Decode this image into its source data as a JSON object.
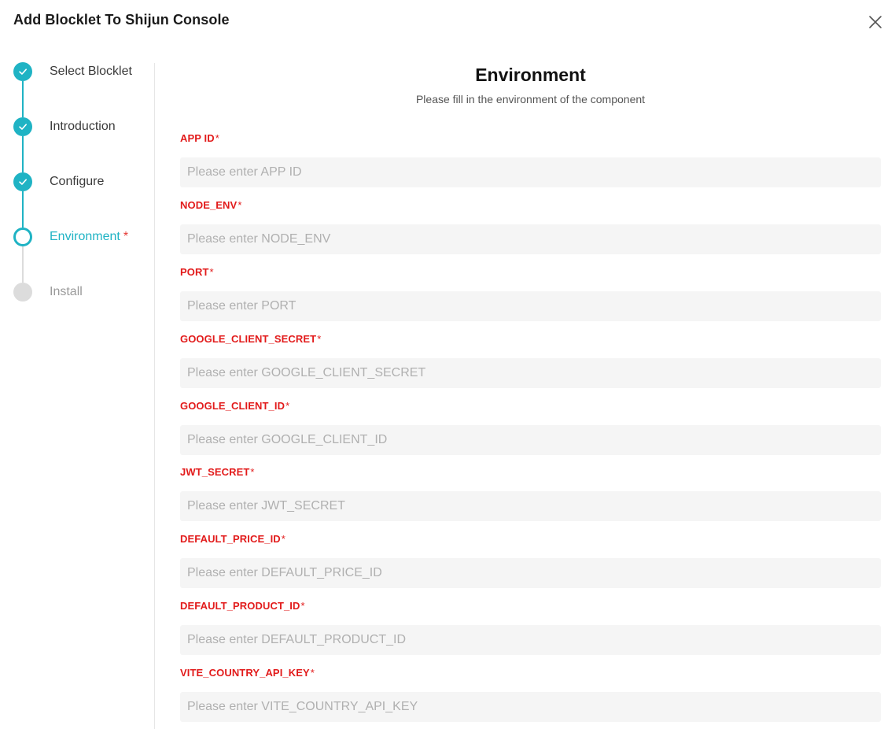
{
  "dialog": {
    "title": "Add Blocklet To Shijun Console"
  },
  "stepper": {
    "steps": [
      {
        "label": "Select Blocklet",
        "state": "done"
      },
      {
        "label": "Introduction",
        "state": "done"
      },
      {
        "label": "Configure",
        "state": "done"
      },
      {
        "label": "Environment",
        "state": "active",
        "required_mark": "*"
      },
      {
        "label": "Install",
        "state": "todo"
      }
    ]
  },
  "section": {
    "title": "Environment",
    "subtitle": "Please fill in the environment of the component"
  },
  "fields": [
    {
      "label": "APP ID",
      "star": "*",
      "value": "",
      "placeholder": "Please enter APP ID"
    },
    {
      "label": "NODE_ENV",
      "star": "*",
      "value": "",
      "placeholder": "Please enter NODE_ENV"
    },
    {
      "label": "PORT",
      "star": "*",
      "value": "",
      "placeholder": "Please enter PORT"
    },
    {
      "label": "GOOGLE_CLIENT_SECRET",
      "star": "*",
      "value": "",
      "placeholder": "Please enter GOOGLE_CLIENT_SECRET"
    },
    {
      "label": "GOOGLE_CLIENT_ID",
      "star": "*",
      "value": "",
      "placeholder": "Please enter GOOGLE_CLIENT_ID"
    },
    {
      "label": "JWT_SECRET",
      "star": "*",
      "value": "",
      "placeholder": "Please enter JWT_SECRET"
    },
    {
      "label": "DEFAULT_PRICE_ID",
      "star": "*",
      "value": "",
      "placeholder": "Please enter DEFAULT_PRICE_ID"
    },
    {
      "label": "DEFAULT_PRODUCT_ID",
      "star": "*",
      "value": "",
      "placeholder": "Please enter DEFAULT_PRODUCT_ID"
    },
    {
      "label": "VITE_COUNTRY_API_KEY",
      "star": "*",
      "value": "",
      "placeholder": "Please enter VITE_COUNTRY_API_KEY"
    }
  ],
  "colors": {
    "accent": "#1fb3c4",
    "required": "#e21b1b",
    "input_bg": "#f5f5f5",
    "inactive_step": "#dcdcdc"
  },
  "icons": {
    "close": "close-icon",
    "step_done": "check-icon"
  }
}
